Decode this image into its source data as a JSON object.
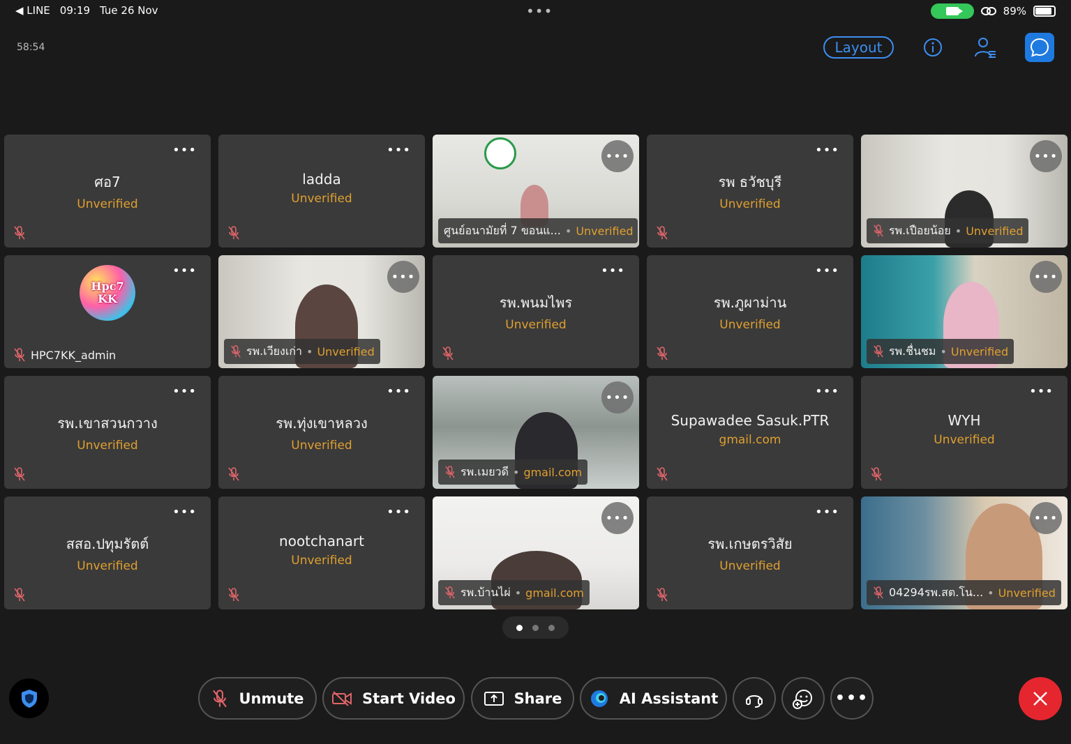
{
  "status_bar": {
    "back_app": "◀ LINE",
    "time": "09:19",
    "date": "Tue 26 Nov",
    "battery": "89%"
  },
  "header": {
    "timer": "58:54",
    "layout_label": "Layout"
  },
  "participants": [
    {
      "name": "ศอ7",
      "status": "Unverified",
      "video": false
    },
    {
      "name": "ladda",
      "status": "Unverified",
      "video": false
    },
    {
      "name": "ศูนย์อนามัยที่ 7 ขอนแ...",
      "status": "Unverified",
      "video": true
    },
    {
      "name": "รพ ธวัชบุรี",
      "status": "Unverified",
      "video": false
    },
    {
      "name": "รพ.เปือยน้อย",
      "status": "Unverified",
      "video": true
    },
    {
      "name": "HPC7KK_admin",
      "status": "",
      "video": false,
      "avatar_text": [
        "Hpc7",
        "KK"
      ]
    },
    {
      "name": "รพ.เวียงเก่า",
      "status": "Unverified",
      "video": true
    },
    {
      "name": "รพ.พนมไพร",
      "status": "Unverified",
      "video": false
    },
    {
      "name": "รพ.ภูผาม่าน",
      "status": "Unverified",
      "video": false
    },
    {
      "name": "รพ.ชื่นชม",
      "status": "Unverified",
      "video": true
    },
    {
      "name": "รพ.เขาสวนกวาง",
      "status": "Unverified",
      "video": false
    },
    {
      "name": "รพ.ทุ่งเขาหลวง",
      "status": "Unverified",
      "video": false
    },
    {
      "name": "รพ.เมยวดี",
      "status": "gmail.com",
      "video": true
    },
    {
      "name": "Supawadee Sasuk.PTR",
      "status": "gmail.com",
      "video": false
    },
    {
      "name": "WYH",
      "status": "Unverified",
      "video": false
    },
    {
      "name": "สสอ.ปทุมรัตต์",
      "status": "Unverified",
      "video": false
    },
    {
      "name": "nootchanart",
      "status": "Unverified",
      "video": false
    },
    {
      "name": "รพ.บ้านไผ่",
      "status": "gmail.com",
      "video": true
    },
    {
      "name": "รพ.เกษตรวิสัย",
      "status": "Unverified",
      "video": false
    },
    {
      "name": "04294รพ.สต.โน...",
      "status": "Unverified",
      "video": true
    }
  ],
  "pager": {
    "pages": 3,
    "current": 1
  },
  "toolbar": {
    "unmute": "Unmute",
    "start_video": "Start Video",
    "share": "Share",
    "ai_assistant": "AI Assistant"
  },
  "colors": {
    "accent": "#3d8ef0",
    "status_text": "#e0a030",
    "muted_icon": "#e0656a",
    "leave": "#e5262f",
    "tile_bg": "#3a3a3a"
  }
}
